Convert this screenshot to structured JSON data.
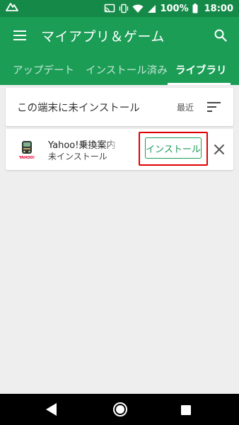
{
  "status_bar": {
    "battery_text": "100%",
    "time": "18:00"
  },
  "app_bar": {
    "title": "マイアプリ＆ゲーム",
    "tabs": [
      {
        "label": "アップデート"
      },
      {
        "label": "インストール済み"
      },
      {
        "label": "ライブラリ"
      }
    ],
    "selected_tab": "ライブラリ"
  },
  "section": {
    "title": "この端末に未インストール",
    "sort_label": "最近"
  },
  "app_item": {
    "name": "Yahoo!乗換案内",
    "status": "未インストール",
    "install_label": "インストール",
    "icon_text": "YAHOO!"
  },
  "colors": {
    "primary": "#1b9d56",
    "status_bar": "#158a48",
    "highlight": "#e00000"
  }
}
